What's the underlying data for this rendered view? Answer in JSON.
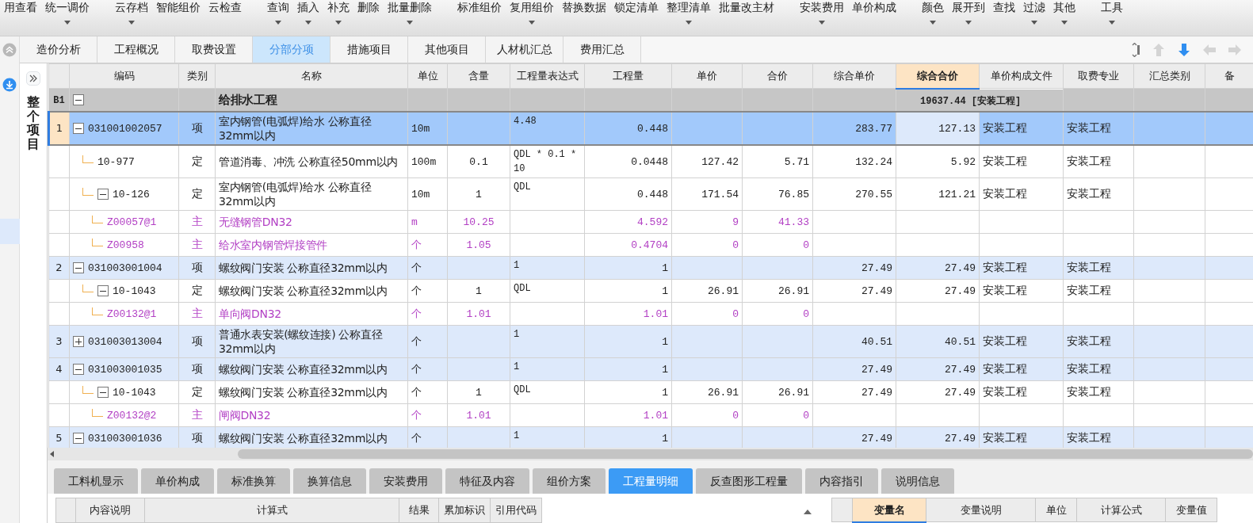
{
  "toolbar": {
    "groups": [
      {
        "items": [
          {
            "label": "用查看",
            "dropdown": false
          },
          {
            "label": "统一调价",
            "dropdown": true
          }
        ]
      },
      {
        "items": [
          {
            "label": "云存档",
            "dropdown": true
          },
          {
            "label": "智能组价",
            "dropdown": false
          },
          {
            "label": "云检查",
            "dropdown": false
          }
        ]
      },
      {
        "items": [
          {
            "label": "查询",
            "dropdown": true
          },
          {
            "label": "插入",
            "dropdown": true
          },
          {
            "label": "补充",
            "dropdown": true
          },
          {
            "label": "删除",
            "dropdown": false
          },
          {
            "label": "批量删除",
            "dropdown": true
          }
        ]
      },
      {
        "items": [
          {
            "label": "标准组价",
            "dropdown": false
          },
          {
            "label": "复用组价",
            "dropdown": true
          },
          {
            "label": "替换数据",
            "dropdown": false
          },
          {
            "label": "锁定清单",
            "dropdown": false
          },
          {
            "label": "整理清单",
            "dropdown": true
          },
          {
            "label": "批量改主材",
            "dropdown": false
          }
        ]
      },
      {
        "items": [
          {
            "label": "安装费用",
            "dropdown": true
          },
          {
            "label": "单价构成",
            "dropdown": false
          }
        ]
      },
      {
        "items": [
          {
            "label": "颜色",
            "dropdown": true
          },
          {
            "label": "展开到",
            "dropdown": true
          },
          {
            "label": "查找",
            "dropdown": false
          },
          {
            "label": "过滤",
            "dropdown": true
          },
          {
            "label": "其他",
            "dropdown": true
          }
        ]
      },
      {
        "items": [
          {
            "label": "工具",
            "dropdown": true
          }
        ]
      }
    ]
  },
  "main_tabs": [
    {
      "label": "造价分析",
      "selected": false
    },
    {
      "label": "工程概况",
      "selected": false
    },
    {
      "label": "取费设置",
      "selected": false
    },
    {
      "label": "分部分项",
      "selected": true
    },
    {
      "label": "措施项目",
      "selected": false
    },
    {
      "label": "其他项目",
      "selected": false
    },
    {
      "label": "人材机汇总",
      "selected": false
    },
    {
      "label": "费用汇总",
      "selected": false
    }
  ],
  "nav_arrows": [
    {
      "kind": "up",
      "disabled": true
    },
    {
      "kind": "down",
      "disabled": false
    },
    {
      "kind": "left",
      "disabled": true
    },
    {
      "kind": "right",
      "disabled": true
    }
  ],
  "side_panel": {
    "title": "整个项目"
  },
  "grid": {
    "columns": [
      {
        "label": "编码",
        "selected": false
      },
      {
        "label": "类别",
        "selected": false
      },
      {
        "label": "名称",
        "selected": false
      },
      {
        "label": "单位",
        "selected": false
      },
      {
        "label": "含量",
        "selected": false
      },
      {
        "label": "工程量表达式",
        "selected": false
      },
      {
        "label": "工程量",
        "selected": false
      },
      {
        "label": "单价",
        "selected": false
      },
      {
        "label": "合价",
        "selected": false
      },
      {
        "label": "综合单价",
        "selected": false
      },
      {
        "label": "综合合价",
        "selected": true
      },
      {
        "label": "单价构成文件",
        "selected": false
      },
      {
        "label": "取费专业",
        "selected": false
      },
      {
        "label": "汇总类别",
        "selected": false
      },
      {
        "label": "备",
        "selected": false
      }
    ],
    "rows": [
      {
        "kind": "section",
        "num": "B1",
        "name": "给排水工程",
        "summary": "19637.44 [安装工程]",
        "expanded": true,
        "selected": false,
        "children": [
          {
            "kind": "bill",
            "num": "1",
            "code": "031001002057",
            "type": "项",
            "name": "室内钢管(电弧焊)给水 公称直径32mm以内",
            "unit": "10m",
            "expr": "4.48",
            "qty": "0.448",
            "comp_price": "283.77",
            "comp_total": "127.13",
            "file": "安装工程",
            "specialty": "安装工程",
            "expanded": true,
            "selected": true,
            "children": [
              {
                "kind": "quota",
                "code": "10-977",
                "type": "定",
                "name": "管道消毒、冲洗 公称直径50mm以内",
                "unit": "100m",
                "content": "0.1",
                "expr": "QDL * 0.1 * 10",
                "qty": "0.0448",
                "price": "127.42",
                "amount": "5.71",
                "comp_price": "132.24",
                "comp_total": "5.92",
                "file": "安装工程",
                "specialty": "安装工程",
                "selected": false
              },
              {
                "kind": "quota",
                "code": "10-126",
                "type": "定",
                "name": "室内钢管(电弧焊)给水 公称直径32mm以内",
                "unit": "10m",
                "content": "1",
                "expr": "QDL",
                "qty": "0.448",
                "price": "171.54",
                "amount": "76.85",
                "comp_price": "270.55",
                "comp_total": "121.21",
                "file": "安装工程",
                "specialty": "安装工程",
                "expanded": true,
                "selected": false,
                "children": [
                  {
                    "kind": "material",
                    "code": "Z00057@1",
                    "type": "主",
                    "name": "无缝钢管DN32",
                    "unit": "m",
                    "content": "10.25",
                    "qty": "4.592",
                    "price": "9",
                    "amount": "41.33",
                    "selected": false
                  },
                  {
                    "kind": "material",
                    "code": "Z00958",
                    "type": "主",
                    "name": "给水室内钢管焊接管件",
                    "unit": "个",
                    "content": "1.05",
                    "qty": "0.4704",
                    "price": "0",
                    "amount": "0",
                    "selected": false
                  }
                ]
              }
            ]
          },
          {
            "kind": "bill",
            "num": "2",
            "code": "031003001004",
            "type": "项",
            "name": "螺纹阀门安装 公称直径32mm以内",
            "unit": "个",
            "expr": "1",
            "qty": "1",
            "comp_price": "27.49",
            "comp_total": "27.49",
            "file": "安装工程",
            "specialty": "安装工程",
            "expanded": true,
            "selected": false,
            "children": [
              {
                "kind": "quota",
                "code": "10-1043",
                "type": "定",
                "name": "螺纹阀门安装 公称直径32mm以内",
                "unit": "个",
                "content": "1",
                "expr": "QDL",
                "qty": "1",
                "price": "26.91",
                "amount": "26.91",
                "comp_price": "27.49",
                "comp_total": "27.49",
                "file": "安装工程",
                "specialty": "安装工程",
                "expanded": true,
                "selected": false,
                "children": [
                  {
                    "kind": "material",
                    "code": "Z00132@1",
                    "type": "主",
                    "name": "单向阀DN32",
                    "unit": "个",
                    "content": "1.01",
                    "qty": "1.01",
                    "price": "0",
                    "amount": "0",
                    "selected": false
                  }
                ]
              }
            ]
          },
          {
            "kind": "bill",
            "num": "3",
            "code": "031003013004",
            "type": "项",
            "name": "普通水表安装(螺纹连接) 公称直径32mm以内",
            "unit": "个",
            "expr": "1",
            "qty": "1",
            "comp_price": "40.51",
            "comp_total": "40.51",
            "file": "安装工程",
            "specialty": "安装工程",
            "expanded": false,
            "selected": false
          },
          {
            "kind": "bill",
            "num": "4",
            "code": "031003001035",
            "type": "项",
            "name": "螺纹阀门安装 公称直径32mm以内",
            "unit": "个",
            "expr": "1",
            "qty": "1",
            "comp_price": "27.49",
            "comp_total": "27.49",
            "file": "安装工程",
            "specialty": "安装工程",
            "expanded": true,
            "selected": false,
            "children": [
              {
                "kind": "quota",
                "code": "10-1043",
                "type": "定",
                "name": "螺纹阀门安装 公称直径32mm以内",
                "unit": "个",
                "content": "1",
                "expr": "QDL",
                "qty": "1",
                "price": "26.91",
                "amount": "26.91",
                "comp_price": "27.49",
                "comp_total": "27.49",
                "file": "安装工程",
                "specialty": "安装工程",
                "expanded": true,
                "selected": false,
                "children": [
                  {
                    "kind": "material",
                    "code": "Z00132@2",
                    "type": "主",
                    "name": "闸阀DN32",
                    "unit": "个",
                    "content": "1.01",
                    "qty": "1.01",
                    "price": "0",
                    "amount": "0",
                    "selected": false
                  }
                ]
              }
            ]
          },
          {
            "kind": "bill",
            "num": "5",
            "code": "031003001036",
            "type": "项",
            "name": "螺纹阀门安装 公称直径32mm以内",
            "unit": "个",
            "expr": "1",
            "qty": "1",
            "comp_price": "27.49",
            "comp_total": "27.49",
            "file": "安装工程",
            "specialty": "安装工程",
            "expanded": true,
            "selected": false
          }
        ]
      }
    ]
  },
  "bottom_tabs": [
    {
      "label": "工料机显示",
      "selected": false
    },
    {
      "label": "单价构成",
      "selected": false
    },
    {
      "label": "标准换算",
      "selected": false
    },
    {
      "label": "换算信息",
      "selected": false
    },
    {
      "label": "安装费用",
      "selected": false
    },
    {
      "label": "特征及内容",
      "selected": false
    },
    {
      "label": "组价方案",
      "selected": false
    },
    {
      "label": "工程量明细",
      "selected": true
    },
    {
      "label": "反查图形工程量",
      "selected": false
    },
    {
      "label": "内容指引",
      "selected": false
    },
    {
      "label": "说明信息",
      "selected": false
    }
  ],
  "detail_table": {
    "columns": [
      {
        "label": "内容说明"
      },
      {
        "label": "计算式"
      },
      {
        "label": "结果"
      },
      {
        "label": "累加标识"
      },
      {
        "label": "引用代码"
      }
    ]
  },
  "variable_table": {
    "columns": [
      {
        "label": "变量名",
        "selected": true
      },
      {
        "label": "变量说明",
        "selected": false
      },
      {
        "label": "单位",
        "selected": false
      },
      {
        "label": "计算公式",
        "selected": false
      },
      {
        "label": "变量值",
        "selected": false
      }
    ]
  }
}
